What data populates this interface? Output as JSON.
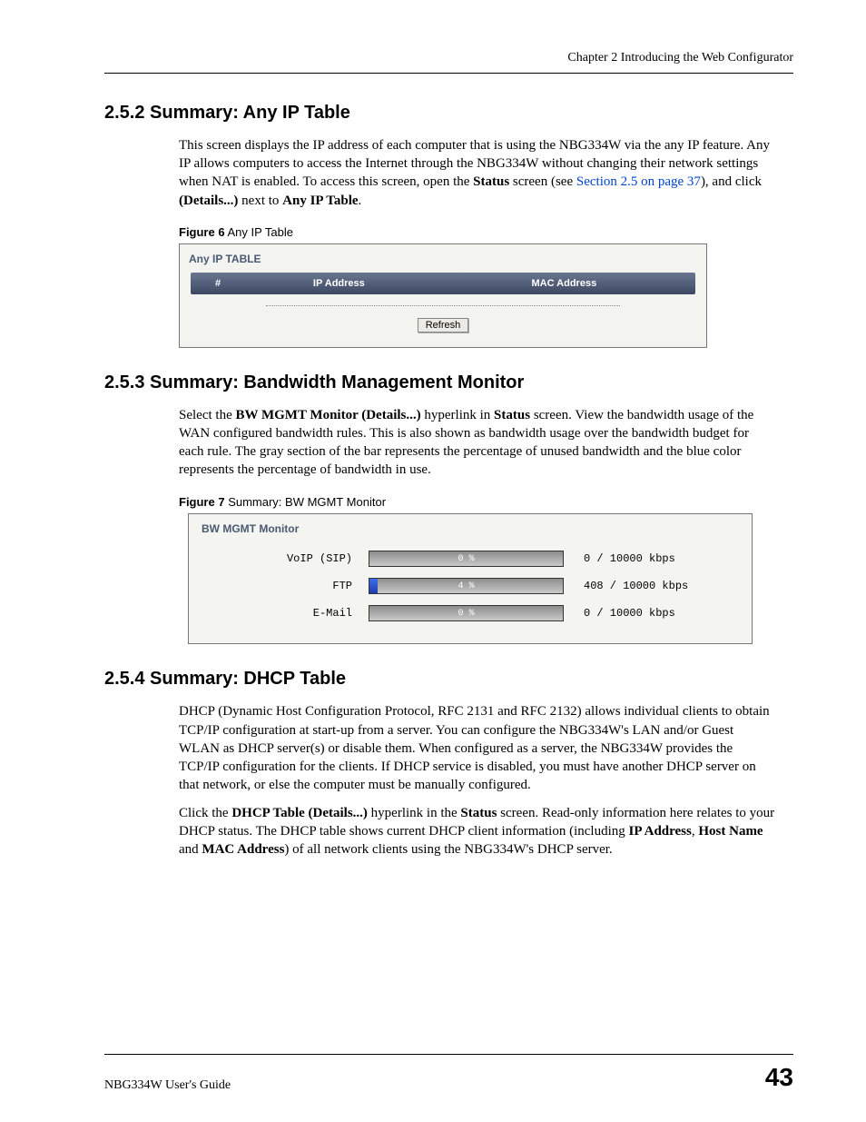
{
  "header": {
    "chapter": "Chapter 2 Introducing the Web Configurator"
  },
  "s252": {
    "heading": "2.5.2  Summary: Any IP Table",
    "p1a": "This screen displays the IP address of each computer that is using the NBG334W via the any IP feature. Any IP allows computers to access the Internet through the NBG334W without changing their network settings when NAT is enabled. To access this screen, open the ",
    "p1b_bold": "Status",
    "p1c": " screen (see ",
    "p1d_link": "Section 2.5 on page 37",
    "p1e": "), and click ",
    "p1f_bold": "(Details...)",
    "p1g": " next to ",
    "p1h_bold": "Any IP Table",
    "p1i": "."
  },
  "fig6": {
    "label_bold": "Figure 6",
    "label_rest": "   Any IP Table",
    "title": "Any IP TABLE",
    "col_hash": "#",
    "col_ip": "IP Address",
    "col_mac": "MAC Address",
    "refresh": "Refresh"
  },
  "s253": {
    "heading": "2.5.3  Summary: Bandwidth Management Monitor",
    "p1a": "Select the ",
    "p1b_bold": "BW MGMT Monitor (Details...)",
    "p1c": " hyperlink in ",
    "p1d_bold": "Status",
    "p1e": " screen. View the bandwidth usage of the WAN configured bandwidth rules. This is also shown as bandwidth usage over the bandwidth budget for each rule. The gray section of the bar represents the percentage of unused bandwidth and the blue color represents the percentage of bandwidth in use."
  },
  "fig7": {
    "label_bold": "Figure 7",
    "label_rest": "   Summary: BW MGMT Monitor",
    "title": "BW MGMT Monitor",
    "rows": [
      {
        "label": "VoIP (SIP)",
        "pct_text": "0 %",
        "fill_pct": 0,
        "value": "0 / 10000  kbps"
      },
      {
        "label": "FTP",
        "pct_text": "4 %",
        "fill_pct": 4,
        "value": "408 / 10000  kbps"
      },
      {
        "label": "E-Mail",
        "pct_text": "0 %",
        "fill_pct": 0,
        "value": "0 / 10000  kbps"
      }
    ]
  },
  "s254": {
    "heading": "2.5.4  Summary: DHCP Table",
    "p1": "DHCP (Dynamic Host Configuration Protocol, RFC 2131 and RFC 2132) allows individual clients to obtain TCP/IP configuration at start-up from a server. You can configure the NBG334W's LAN and/or Guest WLAN as DHCP server(s) or disable them. When configured as a server, the NBG334W provides the TCP/IP configuration for the clients. If DHCP service is disabled, you must have another DHCP server on that network, or else the computer must be manually configured.",
    "p2a": "Click the ",
    "p2b_bold": "DHCP Table (Details...)",
    "p2c": " hyperlink in the ",
    "p2d_bold": "Status",
    "p2e": " screen. Read-only information here relates to your DHCP status. The DHCP table shows current DHCP client information (including ",
    "p2f_bold": "IP Address",
    "p2g": ", ",
    "p2h_bold": "Host Name",
    "p2i": " and ",
    "p2j_bold": "MAC Address",
    "p2k": ") of all network clients using the NBG334W's DHCP server."
  },
  "footer": {
    "guide": "NBG334W User's Guide",
    "page": "43"
  }
}
